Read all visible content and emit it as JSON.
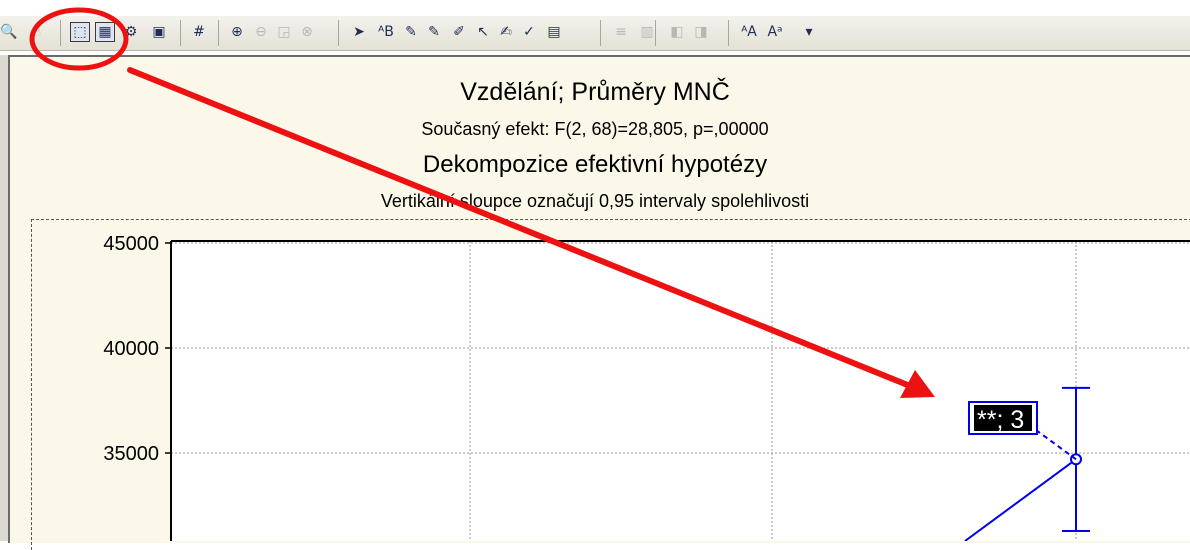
{
  "toolbar": {
    "tools": [
      {
        "name": "find-icon",
        "glyph": "🔍"
      },
      {
        "name": "hand-icon",
        "glyph": "☝"
      },
      {
        "name": "graph-select-icon",
        "glyph": "⬚"
      },
      {
        "name": "graph-data-editor-icon",
        "glyph": "▦"
      },
      {
        "name": "graph-options-icon",
        "glyph": "⚙"
      },
      {
        "name": "graph-window-icon",
        "glyph": "▣"
      },
      {
        "name": "grid-icon",
        "glyph": "#"
      },
      {
        "name": "zoom-in-icon",
        "glyph": "⊕"
      },
      {
        "name": "zoom-out-icon",
        "glyph": "⊖"
      },
      {
        "name": "zoom-fit-icon",
        "glyph": "◲"
      },
      {
        "name": "zoom-reset-icon",
        "glyph": "⊗"
      },
      {
        "name": "pointer-icon",
        "glyph": "➤"
      },
      {
        "name": "text-tool-icon",
        "glyph": "ᴬB"
      },
      {
        "name": "edit-tool-1-icon",
        "glyph": "✎"
      },
      {
        "name": "edit-tool-2-icon",
        "glyph": "✎"
      },
      {
        "name": "edit-tool-3-icon",
        "glyph": "✐"
      },
      {
        "name": "line-tool-icon",
        "glyph": "↖"
      },
      {
        "name": "brush-tool-icon",
        "glyph": "✍"
      },
      {
        "name": "check-tool-icon",
        "glyph": "✓"
      },
      {
        "name": "save-graph-icon",
        "glyph": "▤"
      },
      {
        "name": "align-lines-icon",
        "glyph": "≡"
      },
      {
        "name": "pattern-icon",
        "glyph": "▥"
      },
      {
        "name": "bring-forward-icon",
        "glyph": "◧"
      },
      {
        "name": "send-backward-icon",
        "glyph": "◨"
      },
      {
        "name": "font-increase-icon",
        "glyph": "ᴬA"
      },
      {
        "name": "font-decrease-icon",
        "glyph": "Aᵃ"
      },
      {
        "name": "dropdown-arrow-icon",
        "glyph": "▾"
      }
    ],
    "pressed": [
      "graph-select-icon",
      "graph-data-editor-icon"
    ]
  },
  "graph": {
    "title": "Vzdělání; Průměry MNČ",
    "effect_line": "Současný efekt: F(2, 68)=28,805, p=,00000",
    "decomposition_title": "Dekompozice efektivní hypotézy",
    "note": "Vertikální sloupce označují 0,95 intervaly spolehlivosti",
    "point_label": "**; 3",
    "colors": {
      "series": "#0000ee",
      "highlight": "#ee1111",
      "background": "#fbf8e9",
      "plot_area": "#ffffff"
    }
  },
  "chart_data": {
    "type": "line",
    "ylim": [
      30000,
      45000
    ],
    "ytick_labels": [
      "45000",
      "40000",
      "35000"
    ],
    "ytick_values": [
      45000,
      40000,
      35000
    ],
    "xlabel": "",
    "ylabel": "",
    "points": [
      {
        "label": "**; 3",
        "mean": 34700,
        "ci_low": 30000,
        "ci_high": 38100
      }
    ],
    "grid": true
  }
}
